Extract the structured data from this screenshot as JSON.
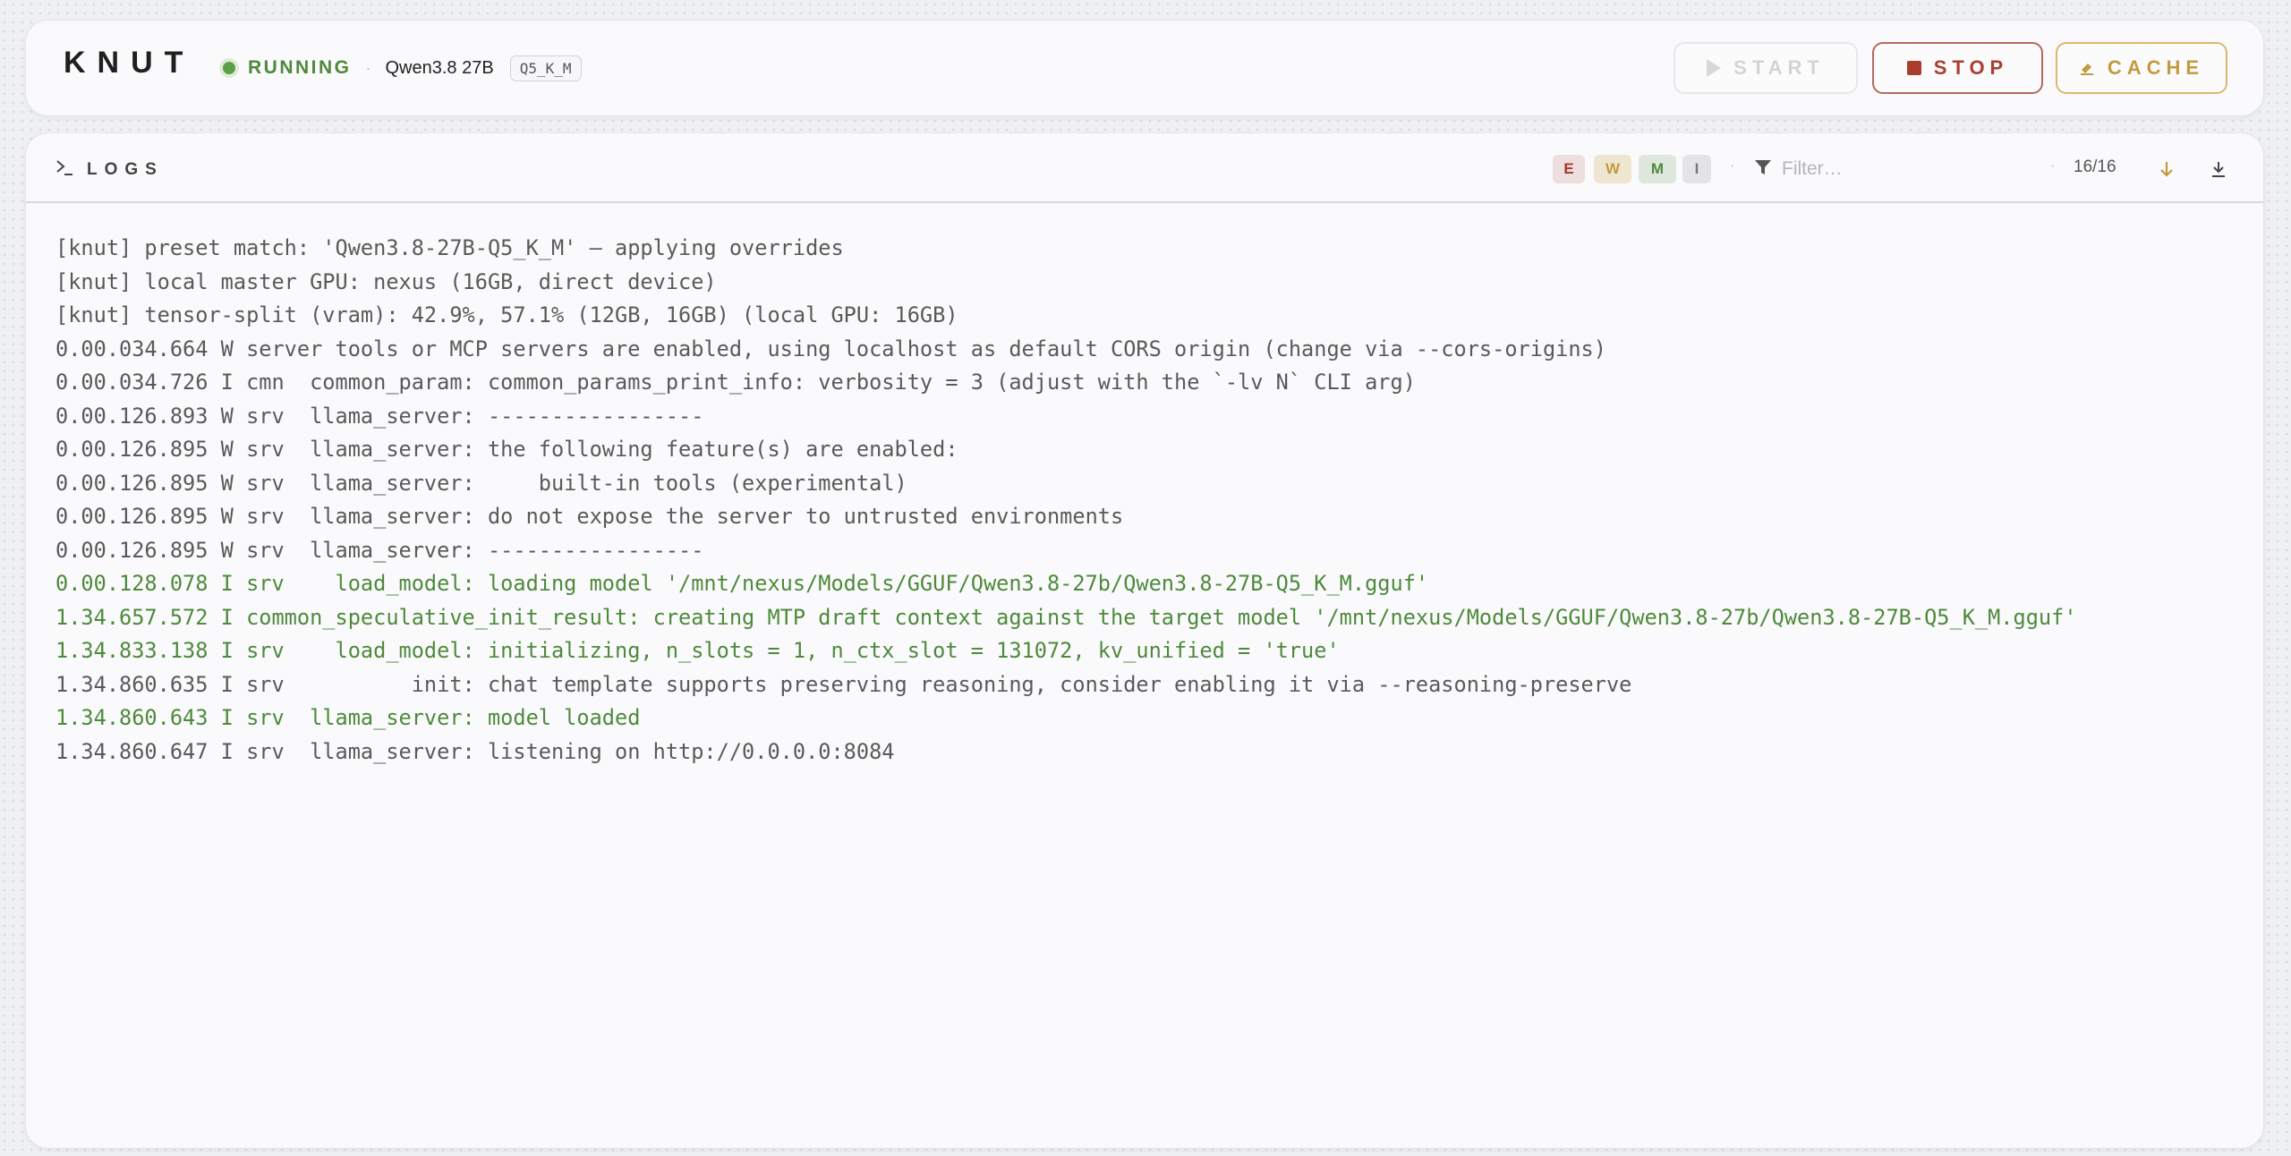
{
  "header": {
    "brand": "KNUT",
    "status": "RUNNING",
    "model": "Qwen3.8 27B",
    "quant": "Q5_K_M",
    "buttons": {
      "start": "START",
      "stop": "STOP",
      "cache": "CACHE"
    }
  },
  "logs": {
    "title": "LOGS",
    "levels": [
      "E",
      "W",
      "M",
      "I"
    ],
    "filter_placeholder": "Filter…",
    "count": "16/16",
    "lines": [
      {
        "text": "[knut] preset match: 'Qwen3.8-27B-Q5_K_M' — applying overrides",
        "color": "default"
      },
      {
        "text": "[knut] local master GPU: nexus (16GB, direct device)",
        "color": "default"
      },
      {
        "text": "[knut] tensor-split (vram): 42.9%, 57.1% (12GB, 16GB) (local GPU: 16GB)",
        "color": "default"
      },
      {
        "text": "0.00.034.664 W server tools or MCP servers are enabled, using localhost as default CORS origin (change via --cors-origins)",
        "color": "default"
      },
      {
        "text": "0.00.034.726 I cmn  common_param: common_params_print_info: verbosity = 3 (adjust with the `-lv N` CLI arg)",
        "color": "default"
      },
      {
        "text": "0.00.126.893 W srv  llama_server: -----------------",
        "color": "default"
      },
      {
        "text": "0.00.126.895 W srv  llama_server: the following feature(s) are enabled:",
        "color": "default"
      },
      {
        "text": "0.00.126.895 W srv  llama_server:     built-in tools (experimental)",
        "color": "default"
      },
      {
        "text": "0.00.126.895 W srv  llama_server: do not expose the server to untrusted environments",
        "color": "default"
      },
      {
        "text": "0.00.126.895 W srv  llama_server: -----------------",
        "color": "default"
      },
      {
        "text": "0.00.128.078 I srv    load_model: loading model '/mnt/nexus/Models/GGUF/Qwen3.8-27b/Qwen3.8-27B-Q5_K_M.gguf'",
        "color": "green"
      },
      {
        "text": "1.34.657.572 I common_speculative_init_result: creating MTP draft context against the target model '/mnt/nexus/Models/GGUF/Qwen3.8-27b/Qwen3.8-27B-Q5_K_M.gguf'",
        "color": "green"
      },
      {
        "text": "1.34.833.138 I srv    load_model: initializing, n_slots = 1, n_ctx_slot = 131072, kv_unified = 'true'",
        "color": "green"
      },
      {
        "text": "1.34.860.635 I srv          init: chat template supports preserving reasoning, consider enabling it via --reasoning-preserve",
        "color": "default"
      },
      {
        "text": "1.34.860.643 I srv  llama_server: model loaded",
        "color": "green"
      },
      {
        "text": "1.34.860.647 I srv  llama_server: listening on http://0.0.0.0:8084",
        "color": "default"
      }
    ]
  },
  "colors": {
    "running": "#4e8a3b",
    "stop": "#a93e2f",
    "cache": "#c39a3d",
    "log_default": "#5a5a5a",
    "log_green": "#4e8a3b"
  },
  "icons": {
    "logs": "terminal-prompt-icon",
    "filter": "funnel-icon",
    "scroll": "arrow-down-icon",
    "download": "download-icon",
    "start": "play-icon",
    "stop": "stop-square-icon",
    "cache": "eraser-icon"
  }
}
